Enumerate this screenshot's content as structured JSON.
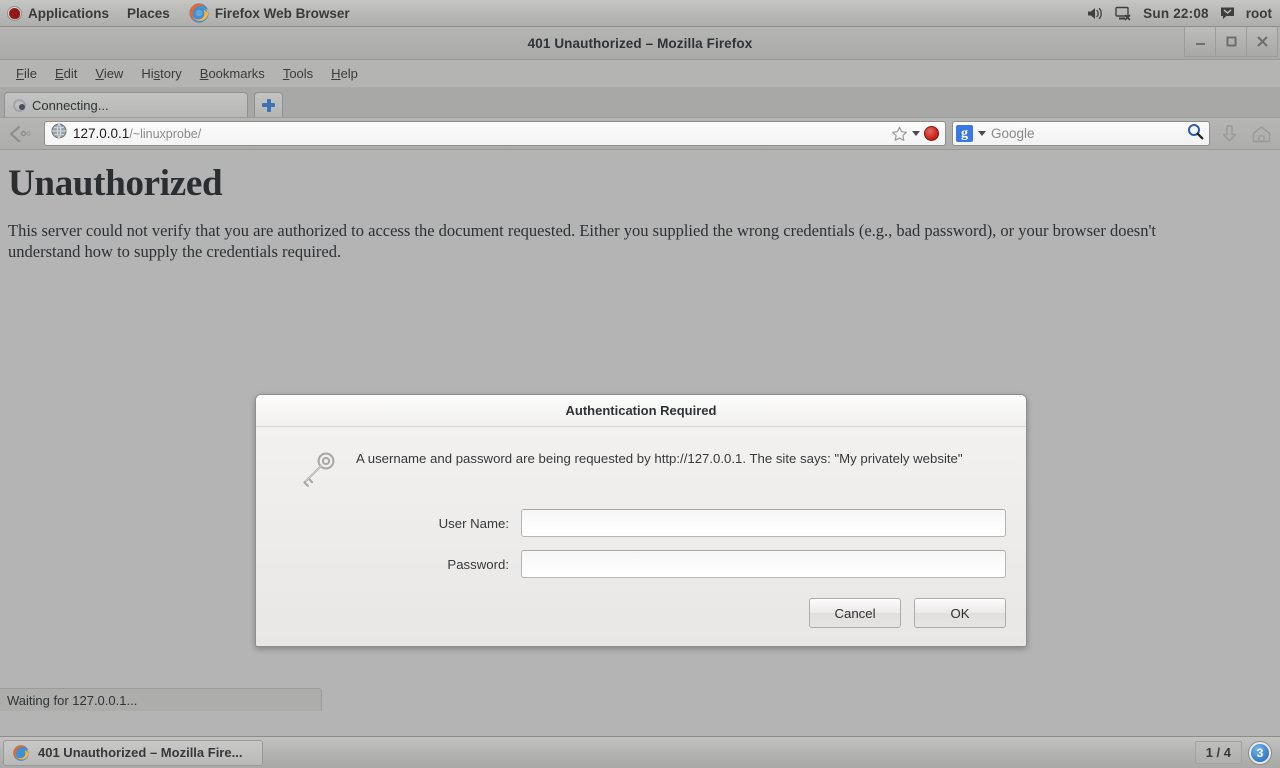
{
  "gnome_panel": {
    "applications_label": "Applications",
    "places_label": "Places",
    "window_label": "Firefox Web Browser",
    "volume_icon": "speaker-icon",
    "network_icon": "network-disconnected-icon",
    "clock": "Sun 22:08",
    "message_icon": "message-icon",
    "user": "root"
  },
  "window": {
    "title": "401 Unauthorized – Mozilla Firefox",
    "minimize_label": "_",
    "maximize_label": "□",
    "close_label": "✕"
  },
  "menubar": {
    "items": [
      {
        "label": "File",
        "accel": "F",
        "rest": "ile"
      },
      {
        "label": "Edit",
        "accel": "E",
        "rest": "dit"
      },
      {
        "label": "View",
        "accel": "V",
        "rest": "iew"
      },
      {
        "label": "History",
        "pre": "Hi",
        "accel": "s",
        "rest": "tory"
      },
      {
        "label": "Bookmarks",
        "accel": "B",
        "rest": "ookmarks"
      },
      {
        "label": "Tools",
        "accel": "T",
        "rest": "ools"
      },
      {
        "label": "Help",
        "accel": "H",
        "rest": "elp"
      }
    ]
  },
  "tabbar": {
    "tab_label": "Connecting...",
    "tab_icon": "loading-spinner-icon",
    "newtab_label": "+",
    "newtab_icon": "plus-icon"
  },
  "navbar": {
    "back_forward_icon": "back-forward-icon",
    "site_icon": "globe-icon",
    "url_host": "127.0.0.1",
    "url_path": "/~linuxprobe/",
    "url_full": "127.0.0.1/~linuxprobe/",
    "bookmark_icon": "star-icon",
    "dropdown_icon": "chevron-down-icon",
    "stop_icon": "stop-icon",
    "search_engine": "Google",
    "search_engine_icon": "google-g-icon",
    "search_placeholder": "Google",
    "search_go_icon": "magnifier-icon",
    "downloads_icon": "download-arrow-icon",
    "home_icon": "home-icon"
  },
  "page": {
    "heading": "Unauthorized",
    "paragraph": "This server could not verify that you are authorized to access the document requested. Either you supplied the wrong credentials (e.g., bad password), or your browser doesn't understand how to supply the credentials required."
  },
  "auth_dialog": {
    "title": "Authentication Required",
    "icon": "key-icon",
    "message": "A username and password are being requested by http://127.0.0.1. The site says: \"My privately website\"",
    "username_label": "User Name:",
    "username_value": "",
    "password_label": "Password:",
    "password_value": "",
    "cancel_label": "Cancel",
    "ok_label": "OK"
  },
  "status": {
    "text": "Waiting for 127.0.0.1..."
  },
  "taskbar": {
    "item_label": "401 Unauthorized – Mozilla Fire...",
    "item_icon": "firefox-icon",
    "workspace": "1 / 4",
    "notification_count": "3"
  },
  "colors": {
    "desktop_bg": "#b4b4b4",
    "panel_bg": "#b9b9b7",
    "accent_blue": "#3b78e7",
    "stop_red": "#cf2b20",
    "badge_blue": "#3e87cc"
  }
}
